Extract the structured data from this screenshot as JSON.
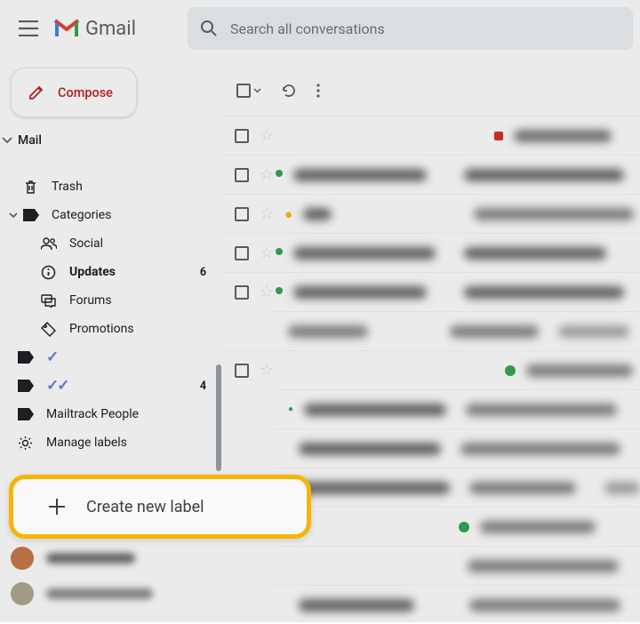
{
  "header": {
    "app_name": "Gmail",
    "search_placeholder": "Search all conversations"
  },
  "compose_label": "Compose",
  "mail_section_label": "Mail",
  "sidebar": {
    "items": [
      {
        "label": "Trash",
        "icon": "trash",
        "count": ""
      },
      {
        "label": "Categories",
        "icon": "categories",
        "count": "",
        "expanded": true
      },
      {
        "label": "Social",
        "icon": "social",
        "count": "",
        "sub": true
      },
      {
        "label": "Updates",
        "icon": "updates",
        "count": "6",
        "sub": true,
        "bold": true
      },
      {
        "label": "Forums",
        "icon": "forums",
        "count": "",
        "sub": true
      },
      {
        "label": "Promotions",
        "icon": "promotions",
        "count": "",
        "sub": true
      },
      {
        "label": "✓",
        "icon": "label",
        "count": "",
        "check": true
      },
      {
        "label": "✓✓",
        "icon": "label",
        "count": "4",
        "check": true,
        "bold": true
      },
      {
        "label": "Mailtrack People",
        "icon": "label",
        "count": ""
      },
      {
        "label": "Manage labels",
        "icon": "gear",
        "count": ""
      }
    ]
  },
  "highlight": {
    "label": "Create new label"
  },
  "colors": {
    "highlight_border": "#f8b500",
    "compose_red": "#c5221f"
  }
}
